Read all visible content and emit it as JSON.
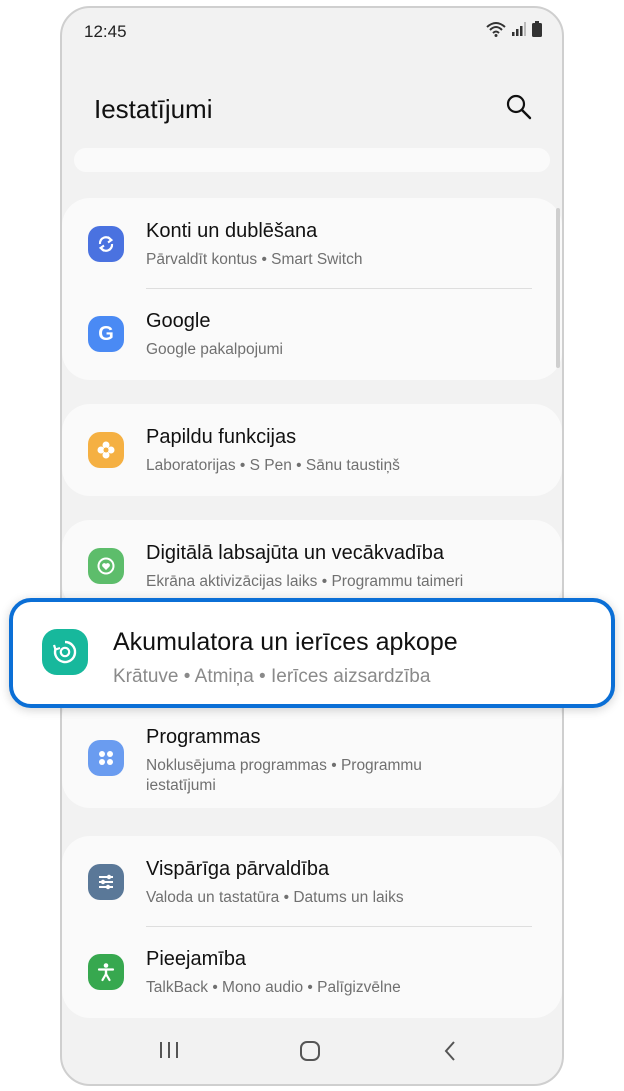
{
  "status": {
    "time": "12:45"
  },
  "header": {
    "title": "Iestatījumi"
  },
  "items": {
    "accounts": {
      "title": "Konti un dublēšana",
      "subtitle": "Pārvaldīt kontus  •  Smart Switch",
      "icon": "sync-icon",
      "color": "#4a72e0"
    },
    "google": {
      "title": "Google",
      "subtitle": "Google pakalpojumi",
      "icon": "google-icon",
      "color": "#4a8af4"
    },
    "advanced": {
      "title": "Papildu funkcijas",
      "subtitle": "Laboratorijas  •  S Pen  •  Sānu taustiņš",
      "icon": "flower-icon",
      "color": "#f5b042"
    },
    "wellbeing": {
      "title": "Digitālā labsajūta un vecākvadība",
      "subtitle": "Ekrāna aktivizācijas laiks  •  Programmu taimeri",
      "icon": "wellbeing-icon",
      "color": "#5dbd6b"
    },
    "battery": {
      "title": "Akumulatora un ierīces apkope",
      "subtitle": "Krātuve  •  Atmiņa  •  Ierīces aizsardzība",
      "icon": "device-care-icon",
      "color": "#17b89c"
    },
    "apps": {
      "title": "Programmas",
      "subtitle": "Noklusējuma programmas  •  Programmu iestatījumi",
      "icon": "apps-icon",
      "color": "#6a9cf0"
    },
    "general": {
      "title": "Vispārīga pārvaldība",
      "subtitle": "Valoda un tastatūra  •  Datums un laiks",
      "icon": "sliders-icon",
      "color": "#5a7898"
    },
    "accessibility": {
      "title": "Pieejamība",
      "subtitle": "TalkBack  •  Mono audio  •  Palīgizvēlne",
      "icon": "accessibility-icon",
      "color": "#37a84f"
    }
  }
}
